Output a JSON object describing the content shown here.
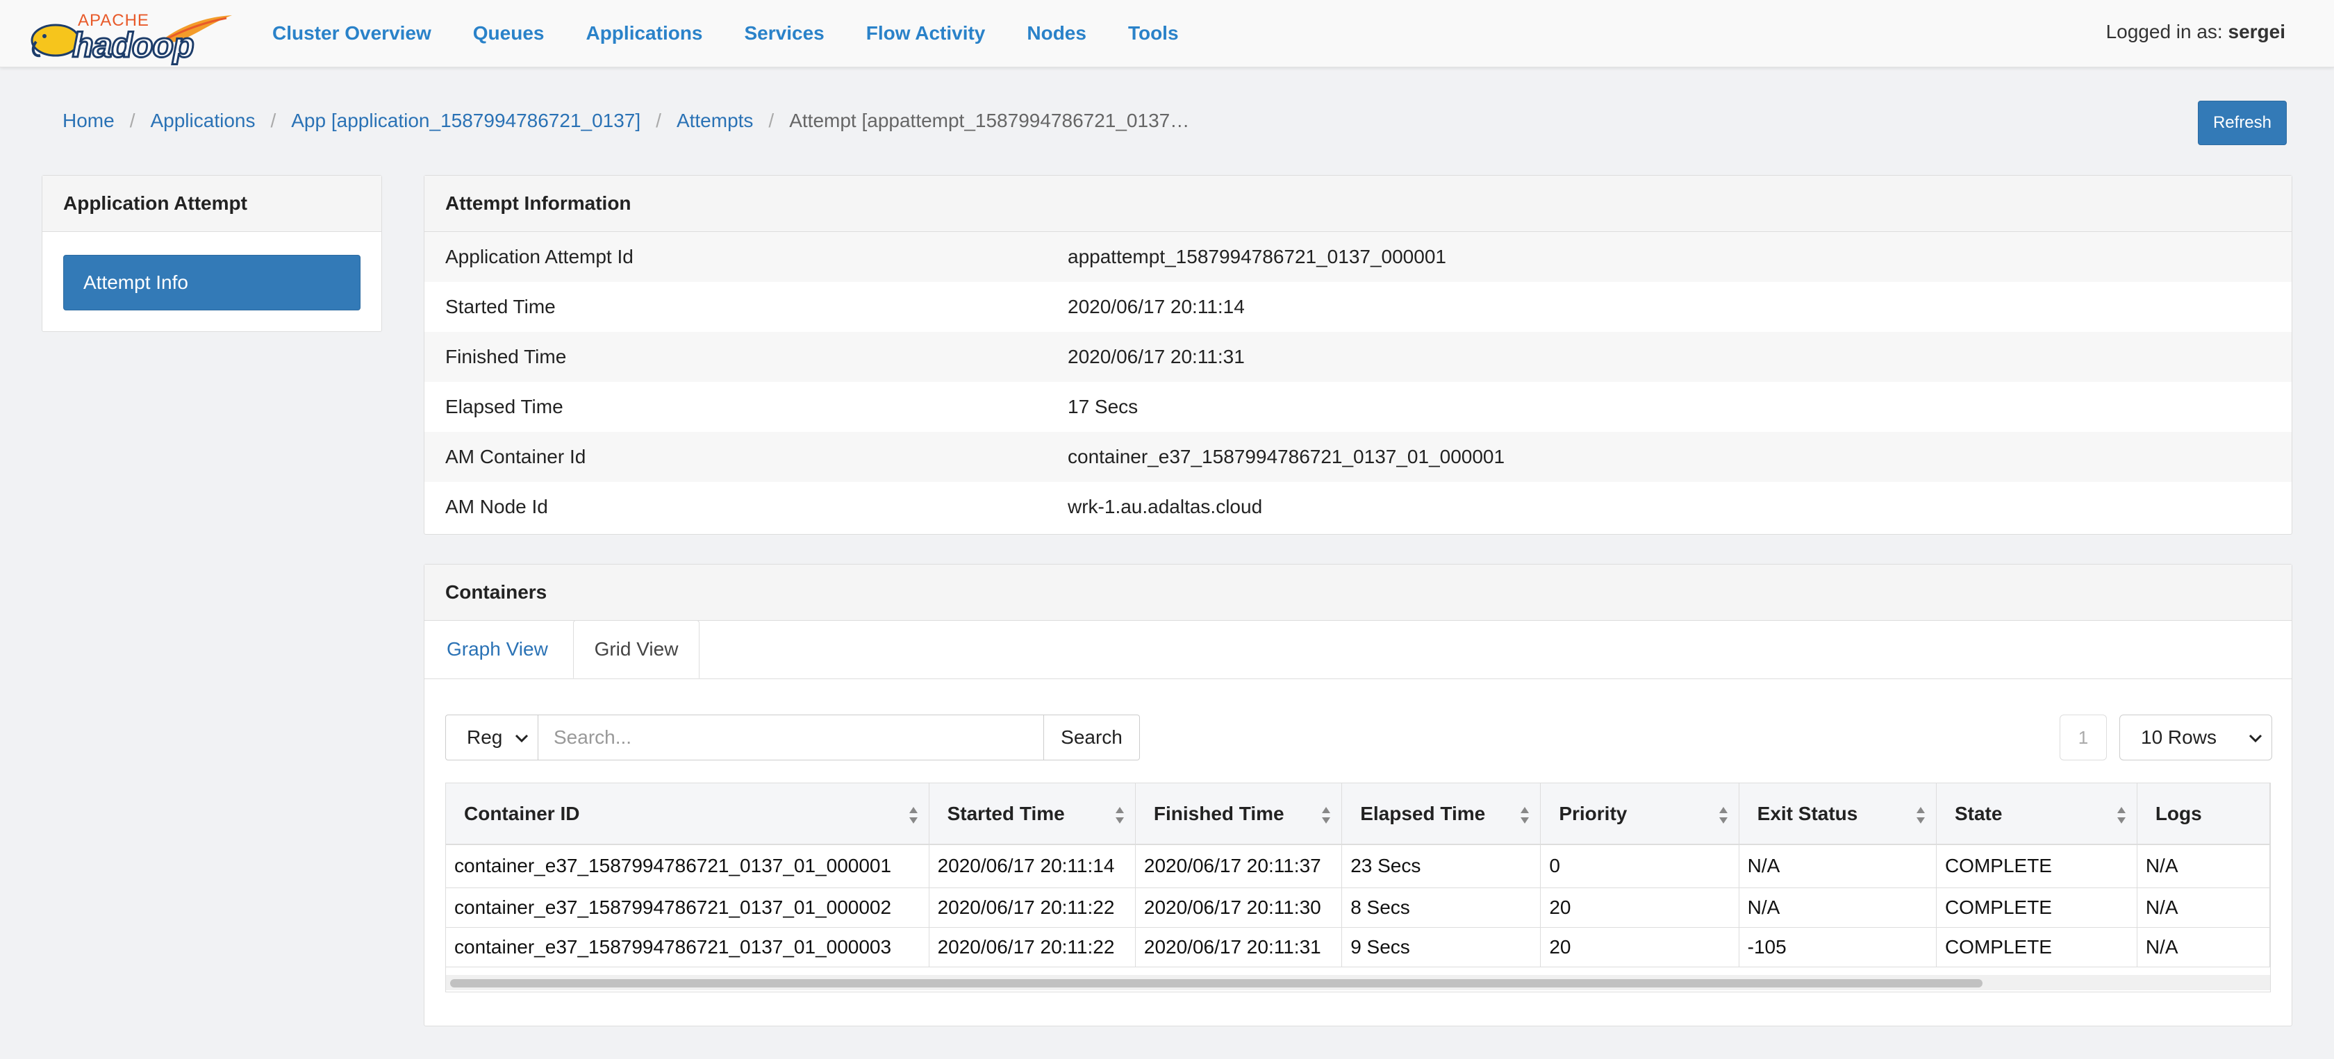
{
  "brand": {
    "apache": "APACHE",
    "name": "hadoop"
  },
  "nav": {
    "links": [
      "Cluster Overview",
      "Queues",
      "Applications",
      "Services",
      "Flow Activity",
      "Nodes",
      "Tools"
    ],
    "logged_in_prefix": "Logged in as:",
    "user": "sergei"
  },
  "breadcrumb": {
    "items": [
      "Home",
      "Applications",
      "App [application_1587994786721_0137]",
      "Attempts"
    ],
    "active": "Attempt [appattempt_1587994786721_0137…"
  },
  "refresh_label": "Refresh",
  "sidebar": {
    "title": "Application Attempt",
    "button": "Attempt Info"
  },
  "attempt_info": {
    "title": "Attempt Information",
    "rows": [
      {
        "label": "Application Attempt Id",
        "value": "appattempt_1587994786721_0137_000001"
      },
      {
        "label": "Started Time",
        "value": "2020/06/17 20:11:14"
      },
      {
        "label": "Finished Time",
        "value": "2020/06/17 20:11:31"
      },
      {
        "label": "Elapsed Time",
        "value": "17 Secs"
      },
      {
        "label": "AM Container Id",
        "value": "container_e37_1587994786721_0137_01_000001"
      },
      {
        "label": "AM Node Id",
        "value": "wrk-1.au.adaltas.cloud"
      }
    ]
  },
  "containers": {
    "title": "Containers",
    "tabs": [
      "Graph View",
      "Grid View"
    ],
    "search": {
      "mode": "Reg",
      "placeholder": "Search...",
      "button": "Search"
    },
    "page": "1",
    "rows_per_page": "10 Rows",
    "columns": [
      "Container ID",
      "Started Time",
      "Finished Time",
      "Elapsed Time",
      "Priority",
      "Exit Status",
      "State",
      "Logs"
    ],
    "rows": [
      [
        "container_e37_1587994786721_0137_01_000001",
        "2020/06/17 20:11:14",
        "2020/06/17 20:11:37",
        "23 Secs",
        "0",
        "N/A",
        "COMPLETE",
        "N/A"
      ],
      [
        "container_e37_1587994786721_0137_01_000002",
        "2020/06/17 20:11:22",
        "2020/06/17 20:11:30",
        "8 Secs",
        "20",
        "N/A",
        "COMPLETE",
        "N/A"
      ],
      [
        "container_e37_1587994786721_0137_01_000003",
        "2020/06/17 20:11:22",
        "2020/06/17 20:11:31",
        "9 Secs",
        "20",
        "-105",
        "COMPLETE",
        "N/A"
      ]
    ]
  }
}
